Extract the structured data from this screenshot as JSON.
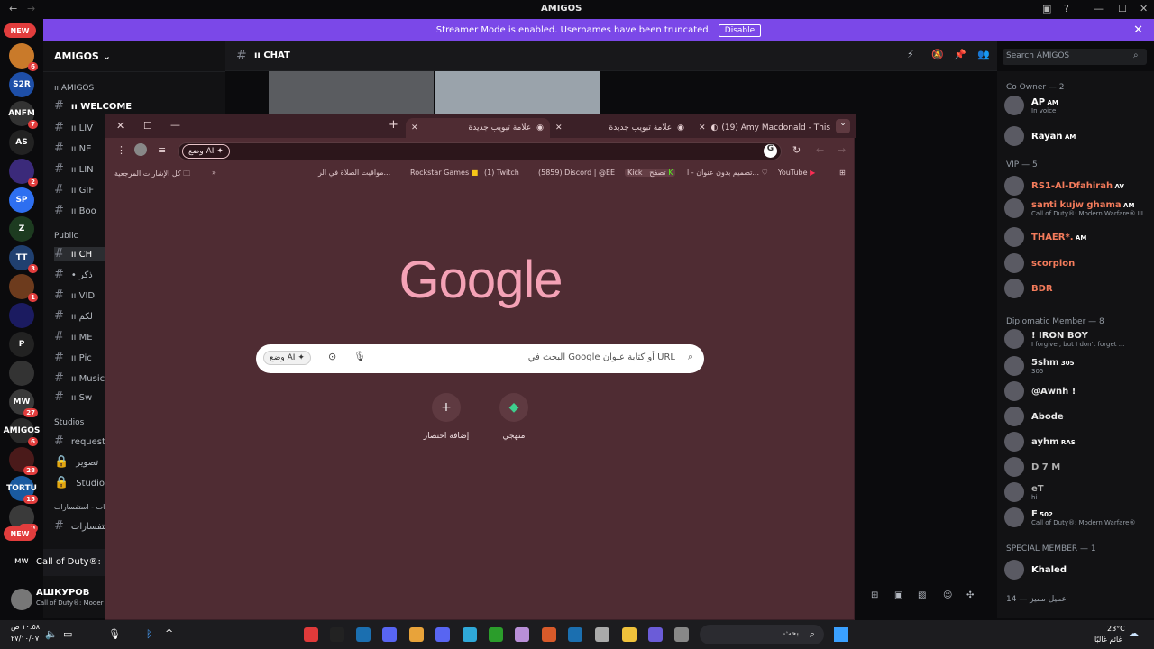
{
  "window": {
    "title": "AMIGOS",
    "icons": [
      "restore-icon",
      "help-icon",
      "minimize-icon",
      "maximize-icon",
      "close-icon"
    ]
  },
  "banner": {
    "text": "Streamer Mode is enabled. Usernames have been truncated.",
    "disable": "Disable"
  },
  "rail": {
    "new_top": "NEW",
    "new_bottom": "NEW",
    "servers": [
      {
        "label": "",
        "badge": "6"
      },
      {
        "label": "S2R",
        "badge": ""
      },
      {
        "label": "ANFM",
        "badge": "7"
      },
      {
        "label": "AS",
        "badge": ""
      },
      {
        "label": "",
        "badge": "2"
      },
      {
        "label": "SP",
        "badge": ""
      },
      {
        "label": "Z",
        "badge": ""
      },
      {
        "label": "TT",
        "badge": "3"
      },
      {
        "label": "",
        "badge": "1"
      },
      {
        "label": "",
        "badge": ""
      },
      {
        "label": "P",
        "badge": ""
      },
      {
        "label": "",
        "badge": ""
      },
      {
        "label": "MW",
        "badge": "27"
      },
      {
        "label": "AMIGOS",
        "badge": "6"
      },
      {
        "label": "",
        "badge": "28"
      },
      {
        "label": "TORTU",
        "badge": "15"
      },
      {
        "label": "",
        "badge": "210"
      }
    ]
  },
  "channels": {
    "server": "AMIGOS",
    "cat1": "ıı AMIGOS",
    "cat2": "Public",
    "cat3": "Studios",
    "cat4": "بيعات - استفسارات",
    "items": [
      "ıı WELCOME",
      "ıı LIV",
      "ıı NE",
      "ıı LIN",
      "ıı GIF",
      "ıı Boo",
      "ıı CH",
      "• ذكر",
      "ıı VID",
      "ıı لكم",
      "ıı ME",
      "ıı Pic",
      "ıı Music",
      "ıı Sw",
      "request-",
      "تصوير",
      "Studio 1",
      "استفسارات"
    ],
    "activity": "Call of Duty®: Mo",
    "user": "АШКУРОВ",
    "user_status": "Call of Duty®: Moder"
  },
  "chat": {
    "channel": "ıı CHAT",
    "search": "Search AMIGOS"
  },
  "members": {
    "groups": [
      {
        "title": "Co Owner — 2",
        "members": [
          {
            "name": "AP",
            "tag": "AM",
            "sub": "In voice"
          },
          {
            "name": "Rayan",
            "tag": "AM",
            "sub": ""
          }
        ]
      },
      {
        "title": "VIP — 5",
        "members": [
          {
            "name": "RS1-Al-Dfahirah",
            "tag": "AV",
            "sub": ""
          },
          {
            "name": "santi kujw ghama",
            "tag": "AM",
            "sub": "Call of Duty®: Modern Warfare® III"
          },
          {
            "name": "THAER*.",
            "tag": "AM",
            "sub": ""
          },
          {
            "name": "scorpion",
            "tag": "",
            "sub": ""
          },
          {
            "name": "BDR",
            "tag": "",
            "sub": ""
          }
        ]
      },
      {
        "title": "Diplomatic Member — 8",
        "members": [
          {
            "name": "! IRON BOY",
            "tag": "",
            "sub": "I forgive , but I don't forget ..."
          },
          {
            "name": "5shm",
            "tag": "305",
            "sub": "305"
          },
          {
            "name": "@Awnh !",
            "tag": "",
            "sub": ""
          },
          {
            "name": "Abode",
            "tag": "",
            "sub": ""
          },
          {
            "name": "ayhm",
            "tag": "RAS",
            "sub": ""
          },
          {
            "name": "D 7 M",
            "tag": "",
            "sub": ""
          },
          {
            "name": "eT",
            "tag": "",
            "sub": "hi"
          },
          {
            "name": "F",
            "tag": "502",
            "sub": "Call of Duty®: Modern Warfare®"
          }
        ]
      },
      {
        "title": "SPECIAL MEMBER — 1",
        "members": [
          {
            "name": "Khaled",
            "tag": "",
            "sub": ""
          }
        ]
      },
      {
        "title": "عميل مميز — 14",
        "members": []
      }
    ],
    "colors": {
      "vip": "#f37b5b",
      "diplo": "#e8e8e8",
      "special": "#ffffff"
    }
  },
  "browser": {
    "tabs": [
      {
        "title": "علامة تبويب جديدة",
        "active": true
      },
      {
        "title": "علامة تبويب جديدة",
        "active": false
      },
      {
        "title": "(19) Amy Macdonald - This",
        "active": false
      }
    ],
    "ai_mode": "وضع AI",
    "bookmarks": [
      "YouTube",
      "تصميم بدون عنوان - ا...",
      "Kick | تصفح",
      "(5859) Discord | @EE",
      "(1) Twitch",
      "Rockstar Games",
      "مواقيت الصلاة في الر...",
      "كل الإشارات المرجعية"
    ],
    "logo": "Google",
    "search_placeholder": "البحث في Google أو كتابة عنوان URL",
    "shortcuts": [
      {
        "label": "منهجي"
      },
      {
        "label": "إضافة اختصار"
      }
    ]
  },
  "taskbar": {
    "time": "١٠:٥٨ ص",
    "date": "٢٧/١٠/٠٧",
    "search": "بحث",
    "weather_temp": "23°C",
    "weather_text": "غائم غالبًا"
  }
}
